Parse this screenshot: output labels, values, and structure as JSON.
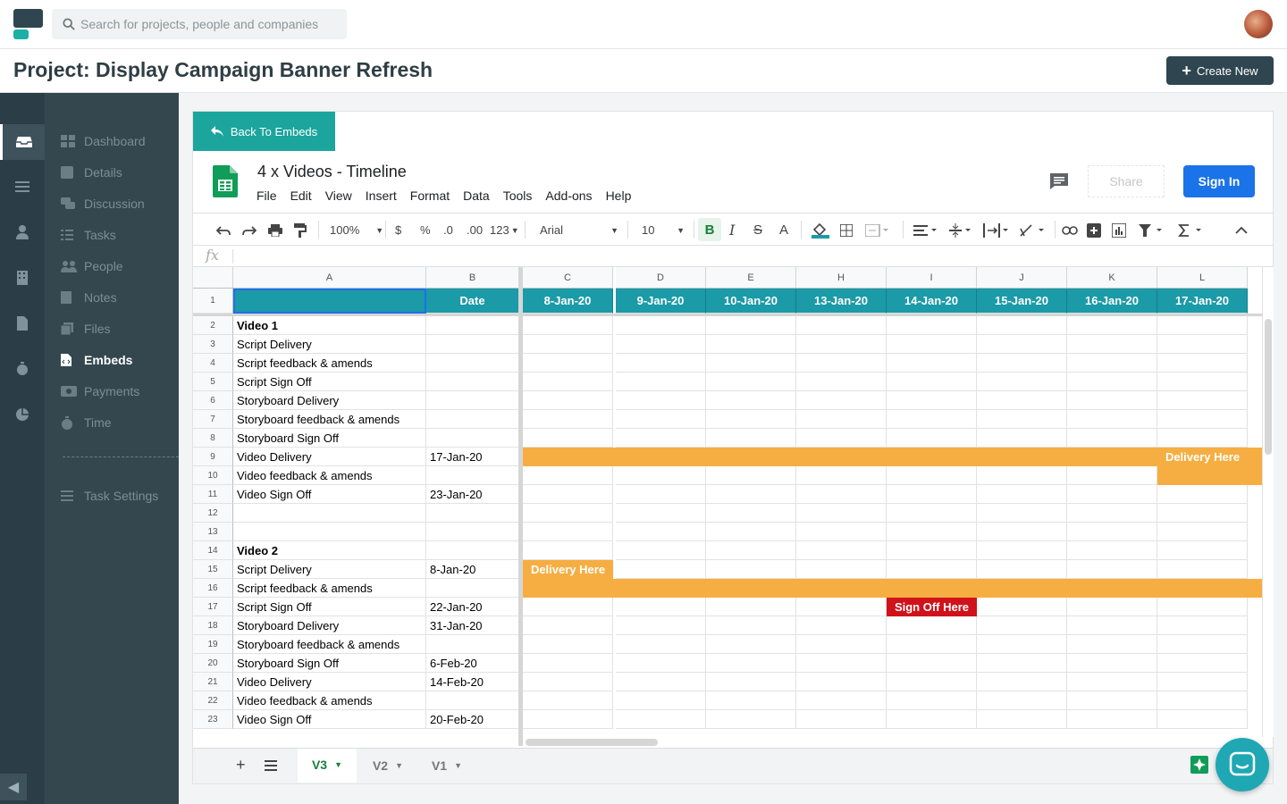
{
  "search": {
    "placeholder": "Search for projects, people and companies"
  },
  "header": {
    "project_title": "Project: Display Campaign Banner Refresh",
    "create_label": "Create New"
  },
  "nav": {
    "items": [
      {
        "label": "Dashboard",
        "icon": "dashboard-icon"
      },
      {
        "label": "Details",
        "icon": "details-icon"
      },
      {
        "label": "Discussion",
        "icon": "discussion-icon"
      },
      {
        "label": "Tasks",
        "icon": "tasks-icon"
      },
      {
        "label": "People",
        "icon": "people-icon"
      },
      {
        "label": "Notes",
        "icon": "notes-icon"
      },
      {
        "label": "Files",
        "icon": "files-icon"
      },
      {
        "label": "Embeds",
        "icon": "embeds-icon",
        "active": true
      },
      {
        "label": "Payments",
        "icon": "payments-icon"
      },
      {
        "label": "Time",
        "icon": "time-icon"
      }
    ],
    "task_settings": "Task Settings"
  },
  "embed": {
    "back_label": "Back To Embeds",
    "doc_title": "4 x Videos - Timeline",
    "menus": [
      "File",
      "Edit",
      "View",
      "Insert",
      "Format",
      "Data",
      "Tools",
      "Add-ons",
      "Help"
    ],
    "share_label": "Share",
    "signin_label": "Sign In"
  },
  "toolbar": {
    "zoom": "100%",
    "currency": "$",
    "percent": "%",
    "dec_less": ".0",
    "dec_more": ".00",
    "format": "123",
    "font": "Arial",
    "size": "10"
  },
  "fx": "fx",
  "sheet": {
    "columns": [
      "A",
      "B",
      "C",
      "D",
      "E",
      "H",
      "I",
      "J",
      "K",
      "L"
    ],
    "date_header": "Date",
    "date_columns": [
      "8-Jan-20",
      "9-Jan-20",
      "10-Jan-20",
      "13-Jan-20",
      "14-Jan-20",
      "15-Jan-20",
      "16-Jan-20",
      "17-Jan-20"
    ],
    "rows": [
      {
        "n": "2",
        "a": "Video 1",
        "b": "",
        "bold": true
      },
      {
        "n": "3",
        "a": "Script Delivery",
        "b": ""
      },
      {
        "n": "4",
        "a": "Script feedback & amends",
        "b": ""
      },
      {
        "n": "5",
        "a": "Script Sign Off",
        "b": ""
      },
      {
        "n": "6",
        "a": "Storyboard Delivery",
        "b": ""
      },
      {
        "n": "7",
        "a": "Storyboard feedback & amends",
        "b": ""
      },
      {
        "n": "8",
        "a": "Storyboard Sign Off",
        "b": ""
      },
      {
        "n": "9",
        "a": "Video Delivery",
        "b": "17-Jan-20"
      },
      {
        "n": "10",
        "a": "Video feedback & amends",
        "b": ""
      },
      {
        "n": "11",
        "a": "Video Sign Off",
        "b": "23-Jan-20"
      },
      {
        "n": "12",
        "a": "",
        "b": ""
      },
      {
        "n": "13",
        "a": "",
        "b": ""
      },
      {
        "n": "14",
        "a": "Video 2",
        "b": "",
        "bold": true
      },
      {
        "n": "15",
        "a": "Script Delivery",
        "b": "8-Jan-20"
      },
      {
        "n": "16",
        "a": "Script feedback & amends",
        "b": ""
      },
      {
        "n": "17",
        "a": "Script Sign Off",
        "b": "22-Jan-20"
      },
      {
        "n": "18",
        "a": "Storyboard Delivery",
        "b": "31-Jan-20"
      },
      {
        "n": "19",
        "a": "Storyboard feedback & amends",
        "b": ""
      },
      {
        "n": "20",
        "a": "Storyboard Sign Off",
        "b": "6-Feb-20"
      },
      {
        "n": "21",
        "a": "Video Delivery",
        "b": "14-Feb-20"
      },
      {
        "n": "22",
        "a": "Video feedback & amends",
        "b": ""
      },
      {
        "n": "23",
        "a": "Video Sign Off",
        "b": "20-Feb-20"
      }
    ],
    "bar_labels": {
      "delivery": "Delivery Here",
      "signoff": "Sign Off Here"
    },
    "colors": {
      "header": "#1b9aa8",
      "bar": "#f6ae42",
      "signoff": "#d0121b"
    }
  },
  "tabs": [
    {
      "label": "V3",
      "active": true
    },
    {
      "label": "V2"
    },
    {
      "label": "V1"
    }
  ]
}
